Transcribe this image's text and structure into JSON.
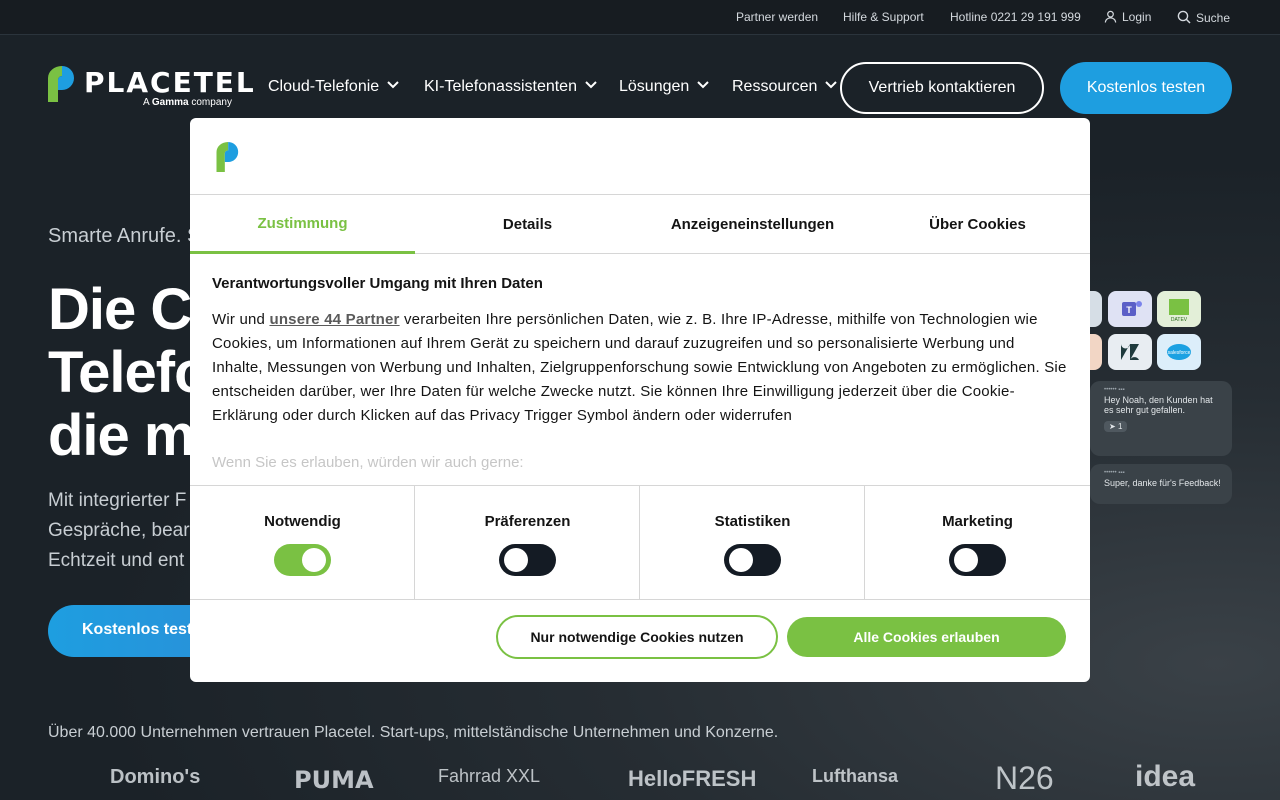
{
  "topbar": {
    "partner": "Partner werden",
    "support": "Hilfe & Support",
    "hotline": "Hotline 0221 29 191 999",
    "login": "Login",
    "search": "Suche"
  },
  "logo": {
    "name": "PLACETEL",
    "tagline_prefix": "A ",
    "tagline_brand": "Gamma",
    "tagline_suffix": " company"
  },
  "nav": {
    "items": [
      {
        "label": "Cloud-Telefonie"
      },
      {
        "label": "KI-Telefonassistenten"
      },
      {
        "label": "Lösungen"
      },
      {
        "label": "Ressourcen"
      }
    ],
    "contact_sales": "Vertrieb kontaktieren",
    "free_trial": "Kostenlos testen"
  },
  "hero": {
    "eyebrow": "Smarte Anrufe. S",
    "title": "Die C\nTelefo\ndie m",
    "text": "Mit integrierter F\nGespräche, bear\nEchtzeit und ent",
    "cta": "Kostenlos test",
    "trust": "Über 40.000 Unternehmen vertrauen Placetel. Start-ups, mittelständische Unternehmen und Konzerne.",
    "brands": [
      "Domino's",
      "PUMA",
      "Fahrrad XXL",
      "HelloFRESH",
      "Lufthansa",
      "N26",
      "idea"
    ],
    "chat_1": {
      "text": "Hey Noah, den Kunden hat es sehr gut gefallen.",
      "reaction": "1"
    },
    "chat_2": {
      "text": "Super, danke für's Feedback!"
    }
  },
  "consent": {
    "tabs": [
      {
        "label": "Zustimmung",
        "active": true
      },
      {
        "label": "Details",
        "active": false
      },
      {
        "label": "Anzeigeneinstellungen",
        "active": false
      },
      {
        "label": "Über Cookies",
        "active": false
      }
    ],
    "title": "Verantwortungsvoller Umgang mit Ihren Daten",
    "text_before_link": "Wir und ",
    "link": "unsere 44 Partner",
    "text_after_link": " verarbeiten Ihre persönlichen Daten, wie z. B. Ihre IP-Adresse, mithilfe von Technologien wie Cookies, um Informationen auf Ihrem Gerät zu speichern und darauf zuzugreifen und so personalisierte Werbung und Inhalte, Messungen von Werbung und Inhalten, Zielgruppenforschung sowie Entwicklung von Angeboten zu ermöglichen. Sie entscheiden darüber, wer Ihre Daten für welche Zwecke nutzt. Sie können Ihre Einwilligung jederzeit über die Cookie-Erklärung oder durch Klicken auf das Privacy Trigger Symbol ändern oder widerrufen",
    "more": "Wenn Sie es erlauben, würden wir auch gerne:",
    "toggles": [
      {
        "label": "Notwendig",
        "on": true
      },
      {
        "label": "Präferenzen",
        "on": false
      },
      {
        "label": "Statistiken",
        "on": false
      },
      {
        "label": "Marketing",
        "on": false
      }
    ],
    "btn_necessary": "Nur notwendige Cookies nutzen",
    "btn_all": "Alle Cookies erlauben"
  },
  "colors": {
    "accent_green": "#7ac143",
    "accent_blue": "#1e9ee0",
    "background": "#1b2228"
  }
}
